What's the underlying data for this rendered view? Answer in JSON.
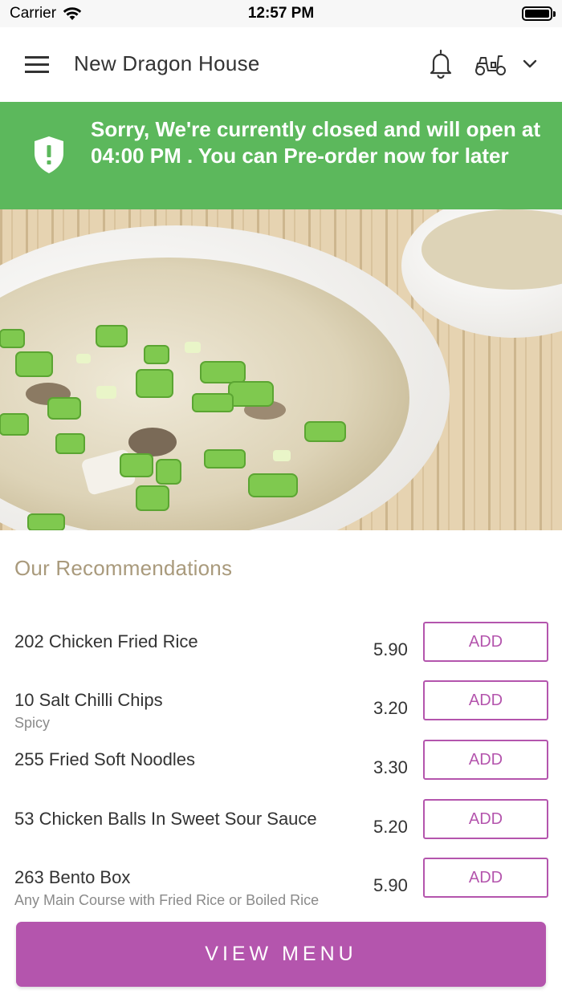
{
  "status_bar": {
    "carrier": "Carrier",
    "time": "12:57 PM"
  },
  "header": {
    "title": "New Dragon House",
    "icons": [
      "menu-icon",
      "bell-icon",
      "scooter-icon",
      "chevron-down-icon"
    ]
  },
  "banner": {
    "message": "Sorry, We're currently closed and will open at 04:00 PM . You can Pre-order now for later",
    "color": "#5cb85c",
    "icon": "shield-alert-icon"
  },
  "recommendations": {
    "title": "Our Recommendations",
    "add_label": "ADD",
    "items": [
      {
        "name": "202 Chicken Fried Rice",
        "description": "",
        "price": "5.90"
      },
      {
        "name": "10 Salt Chilli Chips",
        "description": "Spicy",
        "price": "3.20"
      },
      {
        "name": "255 Fried Soft Noodles",
        "description": "",
        "price": "3.30"
      },
      {
        "name": "53 Chicken Balls In Sweet Sour Sauce",
        "description": "",
        "price": "5.20"
      },
      {
        "name": "263 Bento Box",
        "description": "Any Main Course with Fried Rice or Boiled Rice",
        "price": "5.90"
      }
    ]
  },
  "footer": {
    "view_menu_label": "VIEW MENU"
  },
  "colors": {
    "accent": "#b455ad",
    "section_title": "#a99a7c"
  }
}
